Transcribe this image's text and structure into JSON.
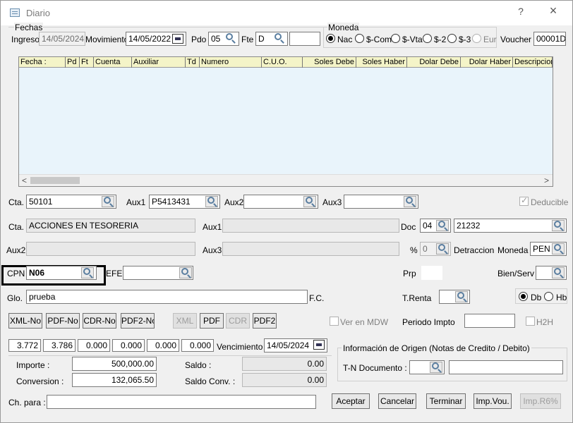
{
  "window": {
    "title": "Diario",
    "help_btn": "?",
    "close_btn": "×"
  },
  "fechas": {
    "legend": "Fechas",
    "ingreso_label": "Ingreso",
    "ingreso_value": "14/05/2024",
    "movimiento_label": "Movimiento",
    "movimiento_value": "14/05/2022",
    "pdo_label": "Pdo",
    "pdo_value": "05",
    "fte_label": "Fte",
    "fte_value": "D",
    "fte_extra": ""
  },
  "moneda": {
    "legend": "Moneda",
    "options": [
      {
        "label": "Nac",
        "selected": true,
        "enabled": true
      },
      {
        "label": "$-Com",
        "selected": false,
        "enabled": true
      },
      {
        "label": "$-Vta",
        "selected": false,
        "enabled": true
      },
      {
        "label": "$-2",
        "selected": false,
        "enabled": true
      },
      {
        "label": "$-3",
        "selected": false,
        "enabled": true
      },
      {
        "label": "Eur",
        "selected": false,
        "enabled": false
      }
    ]
  },
  "voucher": {
    "label": "Voucher",
    "value": "00001D"
  },
  "grid": {
    "columns": [
      "Fecha :",
      "Pd",
      "Ft",
      "Cuenta",
      "Auxiliar",
      "Td",
      "Numero",
      "C.U.O.",
      "Soles Debe",
      "Soles Haber",
      "Dolar Debe",
      "Dolar Haber",
      "Descripcion"
    ],
    "scroll_left": "<",
    "scroll_right": ">"
  },
  "row1": {
    "cta_label": "Cta.",
    "cta_value": "50101",
    "aux1_label": "Aux1",
    "aux1_value": "P5413431",
    "aux2_label": "Aux2",
    "aux2_value": "",
    "aux3_label": "Aux3",
    "aux3_value": "",
    "deducible_label": "Deducible"
  },
  "row2": {
    "cta_label": "Cta.",
    "cta_desc": "ACCIONES EN TESORERIA",
    "aux1_label": "Aux1",
    "aux1_desc": "",
    "doc_label": "Doc",
    "doc_type": "04",
    "doc_number": "21232"
  },
  "row3": {
    "aux2_label": "Aux2",
    "aux2_desc": "",
    "aux3_label": "Aux3",
    "aux3_desc": "",
    "pct_label": "%",
    "pct_value": "0",
    "detraccion_label": "Detraccion",
    "moneda_label": "Moneda :",
    "moneda_value": "PEN"
  },
  "row4": {
    "cpn_label": "CPN",
    "cpn_value": "N06",
    "efe_label": "EFE",
    "efe_value": "",
    "prp_label": "Prp",
    "prp_value": "",
    "bienserv_label": "Bien/Serv",
    "bienserv_value": ""
  },
  "row5": {
    "glo_label": "Glo.",
    "glo_value": "prueba",
    "fc_label": "F.C.",
    "trenta_label": "T.Renta",
    "trenta_value": "",
    "db_label": "Db",
    "hb_label": "Hb"
  },
  "row6": {
    "buttons": [
      "XML-No",
      "PDF-No",
      "CDR-No",
      "PDF2-No"
    ],
    "xml": "XML",
    "pdf": "PDF",
    "cdr": "CDR",
    "pdf2": "PDF2",
    "ver_mdw_label": "Ver en MDW",
    "periodo_label": "Periodo Impto",
    "periodo_value": "",
    "h2h_label": "H2H"
  },
  "row7": {
    "values": [
      "3.772",
      "3.786",
      "0.000",
      "0.000",
      "0.000",
      "0.000"
    ],
    "vencimiento_label": "Vencimiento :",
    "vencimiento_value": "14/05/2024",
    "origen_legend": "Información de Origen (Notas de Credito / Debito)",
    "tn_label": "T-N Documento :",
    "tn_type": "",
    "tn_number": ""
  },
  "totals": {
    "importe_label": "Importe :",
    "importe_value": "500,000.00",
    "saldo_label": "Saldo :",
    "saldo_value": "0.00",
    "conversion_label": "Conversion :",
    "conversion_value": "132,065.50",
    "saldo_conv_label": "Saldo Conv. :",
    "saldo_conv_value": "0.00"
  },
  "footer": {
    "chpara_label": "Ch. para :",
    "chpara_value": "",
    "aceptar": "Aceptar",
    "cancelar": "Cancelar",
    "terminar": "Terminar",
    "impvou": "Imp.Vou.",
    "imprb": "Imp.R6%"
  }
}
